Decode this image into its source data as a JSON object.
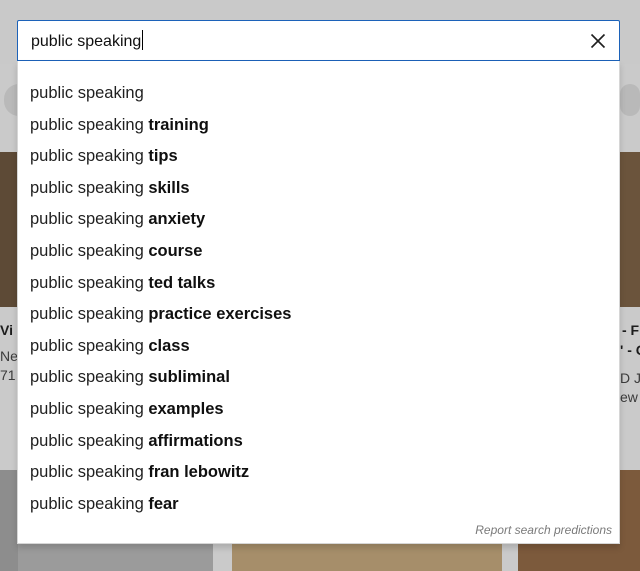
{
  "search": {
    "query": "public speaking",
    "clear_icon": "close-icon"
  },
  "suggestions": [
    {
      "prefix": "public speaking",
      "completion": ""
    },
    {
      "prefix": "public speaking ",
      "completion": "training"
    },
    {
      "prefix": "public speaking ",
      "completion": "tips"
    },
    {
      "prefix": "public speaking ",
      "completion": "skills"
    },
    {
      "prefix": "public speaking ",
      "completion": "anxiety"
    },
    {
      "prefix": "public speaking ",
      "completion": "course"
    },
    {
      "prefix": "public speaking ",
      "completion": "ted talks"
    },
    {
      "prefix": "public speaking ",
      "completion": "practice exercises"
    },
    {
      "prefix": "public speaking ",
      "completion": "class"
    },
    {
      "prefix": "public speaking ",
      "completion": "subliminal"
    },
    {
      "prefix": "public speaking ",
      "completion": "examples"
    },
    {
      "prefix": "public speaking ",
      "completion": "affirmations"
    },
    {
      "prefix": "public speaking ",
      "completion": "fran lebowitz"
    },
    {
      "prefix": "public speaking ",
      "completion": "fear"
    }
  ],
  "report_label": "Report search predictions",
  "background": {
    "left_fragments": [
      "Vi g",
      "Ne",
      "71"
    ],
    "right_fragments": [
      "- F",
      "' - C",
      "D JC",
      "ew"
    ]
  },
  "colors": {
    "focus_border": "#1c62b9",
    "overlay": "#c9c9c9"
  }
}
